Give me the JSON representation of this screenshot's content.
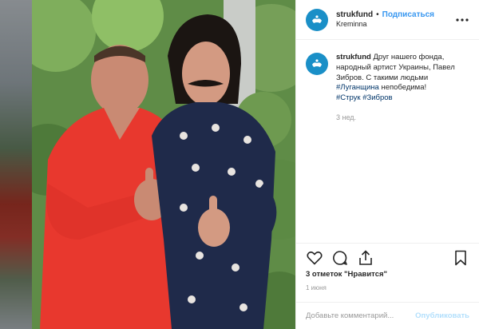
{
  "post": {
    "username": "strukfund",
    "follow_label": "Подписаться",
    "separator": "•",
    "location": "Kreminna",
    "caption": {
      "username": "strukfund",
      "text": "Друг нашего фонда, народный артист Украины, Павел Зибров. С такими людьми",
      "hashtag_1": "#Луганщина",
      "text_after_1": "непобедима!",
      "hashtag_2": "#Струк",
      "hashtag_3": "#Зибров"
    },
    "time_ago": "3 нед.",
    "likes_text": "3 отметок \"Нравится\"",
    "date": "1 июня",
    "comment_placeholder": "Добавьте комментарий...",
    "publish_label": "Опубликовать"
  },
  "icons": {
    "avatar": "hands-logo-icon",
    "more": "more-options-icon",
    "like": "heart-icon",
    "comment": "comment-bubble-icon",
    "share": "share-icon",
    "save": "bookmark-icon"
  },
  "colors": {
    "brand_blue": "#1a8fc7",
    "link_blue": "#3897f0",
    "hashtag": "#003569",
    "muted": "#999999",
    "publish_disabled": "#b2dffc"
  }
}
